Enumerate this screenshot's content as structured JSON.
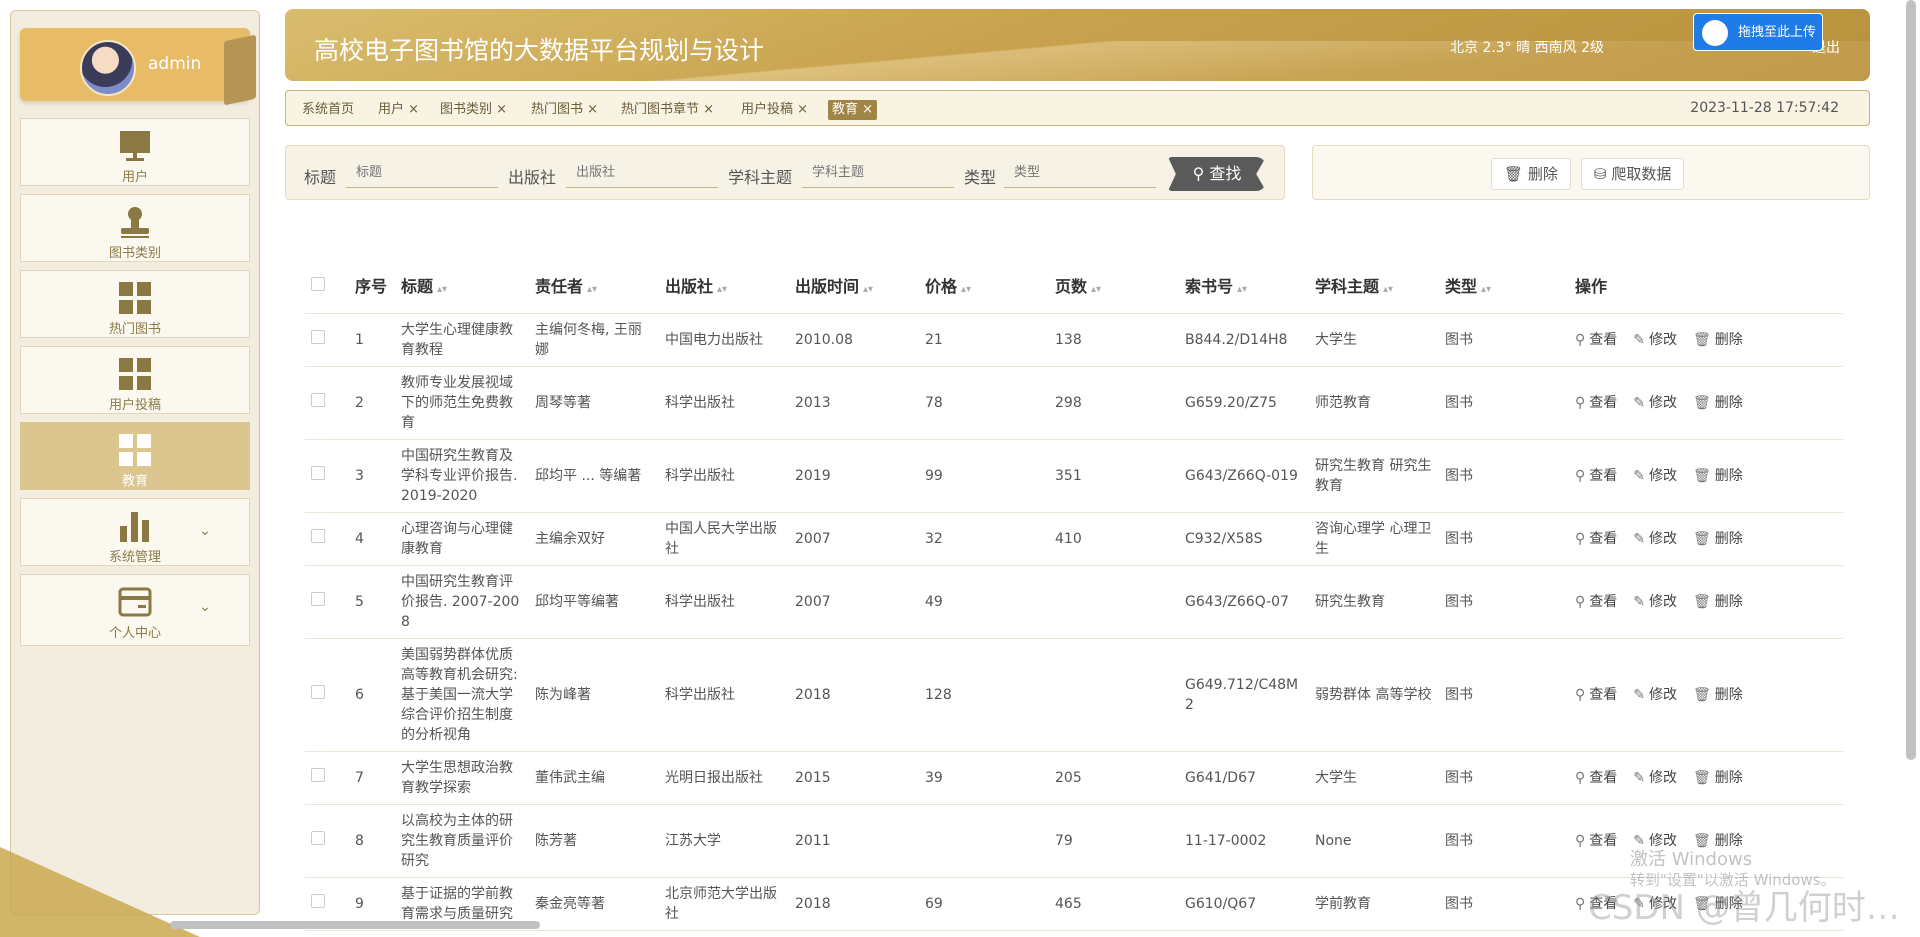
{
  "app": {
    "title": "高校电子图书馆的大数据平台规划与设计",
    "weather": "北京  2.3°  晴  西南风  2级",
    "logout": "退出",
    "upload": "拖拽至此上传",
    "datetime": "2023-11-28 17:57:42"
  },
  "user": {
    "name": "admin"
  },
  "sidebar": {
    "items": [
      {
        "label": "用户",
        "icon": "monitor-icon"
      },
      {
        "label": "图书类别",
        "icon": "stamp-icon"
      },
      {
        "label": "热门图书",
        "icon": "grid-icon"
      },
      {
        "label": "用户投稿",
        "icon": "grid-icon"
      },
      {
        "label": "教育",
        "icon": "grid-icon",
        "active": true
      },
      {
        "label": "系统管理",
        "icon": "bar-chart-icon"
      },
      {
        "label": "个人中心",
        "icon": "card-icon"
      }
    ]
  },
  "tabs": [
    {
      "label": "系统首页"
    },
    {
      "label": "用户 ×"
    },
    {
      "label": "图书类别 ×"
    },
    {
      "label": "热门图书 ×"
    },
    {
      "label": "热门图书章节 ×"
    },
    {
      "label": "用户投稿 ×"
    },
    {
      "label": "教育 ×",
      "active": true
    }
  ],
  "search": {
    "title_label": "标题",
    "title_placeholder": "标题",
    "publisher_label": "出版社",
    "publisher_placeholder": "出版社",
    "subject_label": "学科主题",
    "subject_placeholder": "学科主题",
    "type_label": "类型",
    "type_placeholder": "类型",
    "button": "查找"
  },
  "actions": {
    "delete": "删除",
    "crawl": "爬取数据"
  },
  "table": {
    "headers": {
      "index": "序号",
      "title": "标题",
      "author": "责任者",
      "publisher": "出版社",
      "date": "出版时间",
      "price": "价格",
      "pages": "页数",
      "call_no": "索书号",
      "subject": "学科主题",
      "type": "类型",
      "ops": "操作"
    },
    "op_view": "查看",
    "op_edit": "修改",
    "op_delete": "删除",
    "rows": [
      {
        "index": "1",
        "title": "大学生心理健康教育教程",
        "author": "主编何冬梅, 王丽娜",
        "publisher": "中国电力出版社",
        "date": "2010.08",
        "price": "21",
        "pages": "138",
        "call_no": "B844.2/D14H8",
        "subject": "大学生",
        "type": "图书"
      },
      {
        "index": "2",
        "title": "教师专业发展视域下的师范生免费教育",
        "author": "周琴等著",
        "publisher": "科学出版社",
        "date": "2013",
        "price": "78",
        "pages": "298",
        "call_no": "G659.20/Z75",
        "subject": "师范教育",
        "type": "图书"
      },
      {
        "index": "3",
        "title": "中国研究生教育及学科专业评价报告. 2019-2020",
        "author": "邱均平 ... 等编著",
        "publisher": "科学出版社",
        "date": "2019",
        "price": "99",
        "pages": "351",
        "call_no": "G643/Z66Q-019",
        "subject": "研究生教育 研究生教育",
        "type": "图书"
      },
      {
        "index": "4",
        "title": "心理咨询与心理健康教育",
        "author": "主编余双好",
        "publisher": "中国人民大学出版社",
        "date": "2007",
        "price": "32",
        "pages": "410",
        "call_no": "C932/X58S",
        "subject": "咨询心理学 心理卫生",
        "type": "图书"
      },
      {
        "index": "5",
        "title": "中国研究生教育评价报告. 2007-2008",
        "author": "邱均平等编著",
        "publisher": "科学出版社",
        "date": "2007",
        "price": "49",
        "pages": "",
        "call_no": "G643/Z66Q-07",
        "subject": "研究生教育",
        "type": "图书"
      },
      {
        "index": "6",
        "title": "美国弱势群体优质高等教育机会研究: 基于美国一流大学综合评价招生制度的分析视角",
        "author": "陈为峰著",
        "publisher": "科学出版社",
        "date": "2018",
        "price": "128",
        "pages": "",
        "call_no": "G649.712/C48M2",
        "subject": "弱势群体 高等学校",
        "type": "图书"
      },
      {
        "index": "7",
        "title": "大学生思想政治教育教学探索",
        "author": "董伟武主编",
        "publisher": "光明日报出版社",
        "date": "2015",
        "price": "39",
        "pages": "205",
        "call_no": "G641/D67",
        "subject": "大学生",
        "type": "图书"
      },
      {
        "index": "8",
        "title": "以高校为主体的研究生教育质量评价研究",
        "author": "陈芳著",
        "publisher": "江苏大学",
        "date": "2011",
        "price": "",
        "pages": "79",
        "call_no": "11-17-0002",
        "subject": "None",
        "type": "图书"
      },
      {
        "index": "9",
        "title": "基于证据的学前教育需求与质量研究",
        "author": "秦金亮等著",
        "publisher": "北京师范大学出版社",
        "date": "2018",
        "price": "69",
        "pages": "465",
        "call_no": "G610/Q67",
        "subject": "学前教育",
        "type": "图书"
      }
    ]
  },
  "watermarks": {
    "activate": "激活 Windows",
    "activate_hint": "转到\"设置\"以激活 Windows。",
    "csdn": "CSDN @曾几何时…"
  }
}
